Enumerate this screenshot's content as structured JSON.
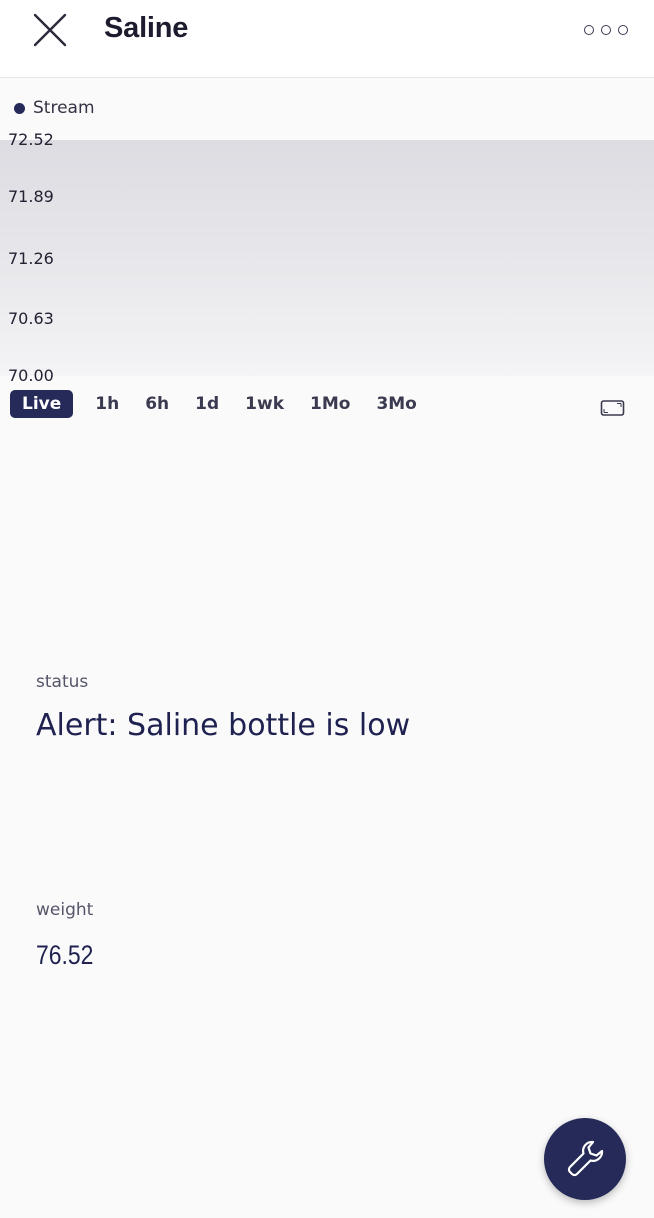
{
  "header": {
    "title": "Saline",
    "close_icon": "close-icon",
    "more_icon": "more-options-icon"
  },
  "chart": {
    "legend": "Stream",
    "y_ticks": [
      "72.52",
      "71.89",
      "71.26",
      "70.63",
      "70.00"
    ],
    "ranges": [
      "Live",
      "1h",
      "6h",
      "1d",
      "1wk",
      "1Mo",
      "3Mo"
    ],
    "selected_range": "Live",
    "expand_icon": "expand-icon",
    "accent_color": "#252a58"
  },
  "status": {
    "label": "status",
    "value": "Alert: Saline bottle is low"
  },
  "weight": {
    "label": "weight",
    "value": "76.52"
  },
  "fab": {
    "icon": "wrench-icon"
  }
}
